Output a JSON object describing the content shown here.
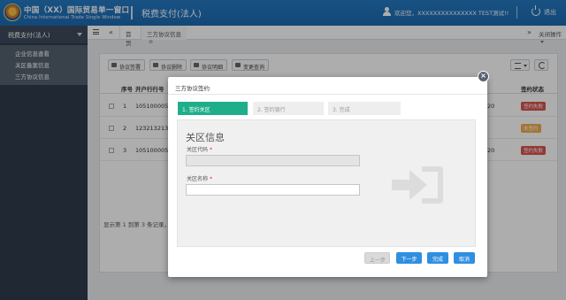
{
  "header": {
    "brand_cn": "中国（XX）国际贸易单一窗口",
    "brand_en": "China International Trade Single Window",
    "title": "税费支付(法人)",
    "welcome": "欢迎您，XXXXXXXXXXXXXXX TEST测试!!",
    "logout": "退出"
  },
  "sidebar": {
    "header": "税费支付(法人)",
    "items": [
      {
        "label": "企业信息查看"
      },
      {
        "label": "关区备案信息"
      },
      {
        "label": "三方协议信息"
      }
    ]
  },
  "tabs": {
    "home": "首页",
    "active": "三方协议信息",
    "close_ops": "关闭操作"
  },
  "toolbar": {
    "buttons": [
      {
        "label": "协议签署"
      },
      {
        "label": "协议删除"
      },
      {
        "label": "协议明细"
      },
      {
        "label": "变更查询"
      }
    ]
  },
  "table": {
    "headers": [
      "序号",
      "开户行行号",
      "签约",
      "签约状态"
    ],
    "rows": [
      {
        "no": "1",
        "bank": "105100005C",
        "date": "20",
        "status": "签约失败",
        "status_color": "#d9534f"
      },
      {
        "no": "2",
        "bank": "123213213",
        "date": "",
        "status": "未签约",
        "status_color": "#f0ad4e"
      },
      {
        "no": "3",
        "bank": "105100005C",
        "date": "20",
        "status": "签约失败",
        "status_color": "#d9534f"
      }
    ],
    "pager": "显示第 1 到第 3 条记录，总"
  },
  "modal": {
    "title": "三方协议签约",
    "close_icon": "close-icon",
    "steps": [
      {
        "label": "1. 签约关区",
        "state": "active"
      },
      {
        "label": "2. 签约银行",
        "state": "idle"
      },
      {
        "label": "3. 完成",
        "state": "idle"
      }
    ],
    "section_title": "关区信息",
    "fields": [
      {
        "label": "关区代码",
        "required": "*",
        "value": "",
        "disabled": true
      },
      {
        "label": "关区名称",
        "required": "*",
        "value": "",
        "disabled": false
      }
    ],
    "buttons": {
      "prev": "上一步",
      "next": "下一步",
      "finish": "完成",
      "cancel": "取消"
    }
  },
  "colors": {
    "header_blue": "#1f70b8",
    "sidebar_dark": "#2f3b4c",
    "step_active": "#1fae8a",
    "primary_button": "#2f8fe0"
  }
}
